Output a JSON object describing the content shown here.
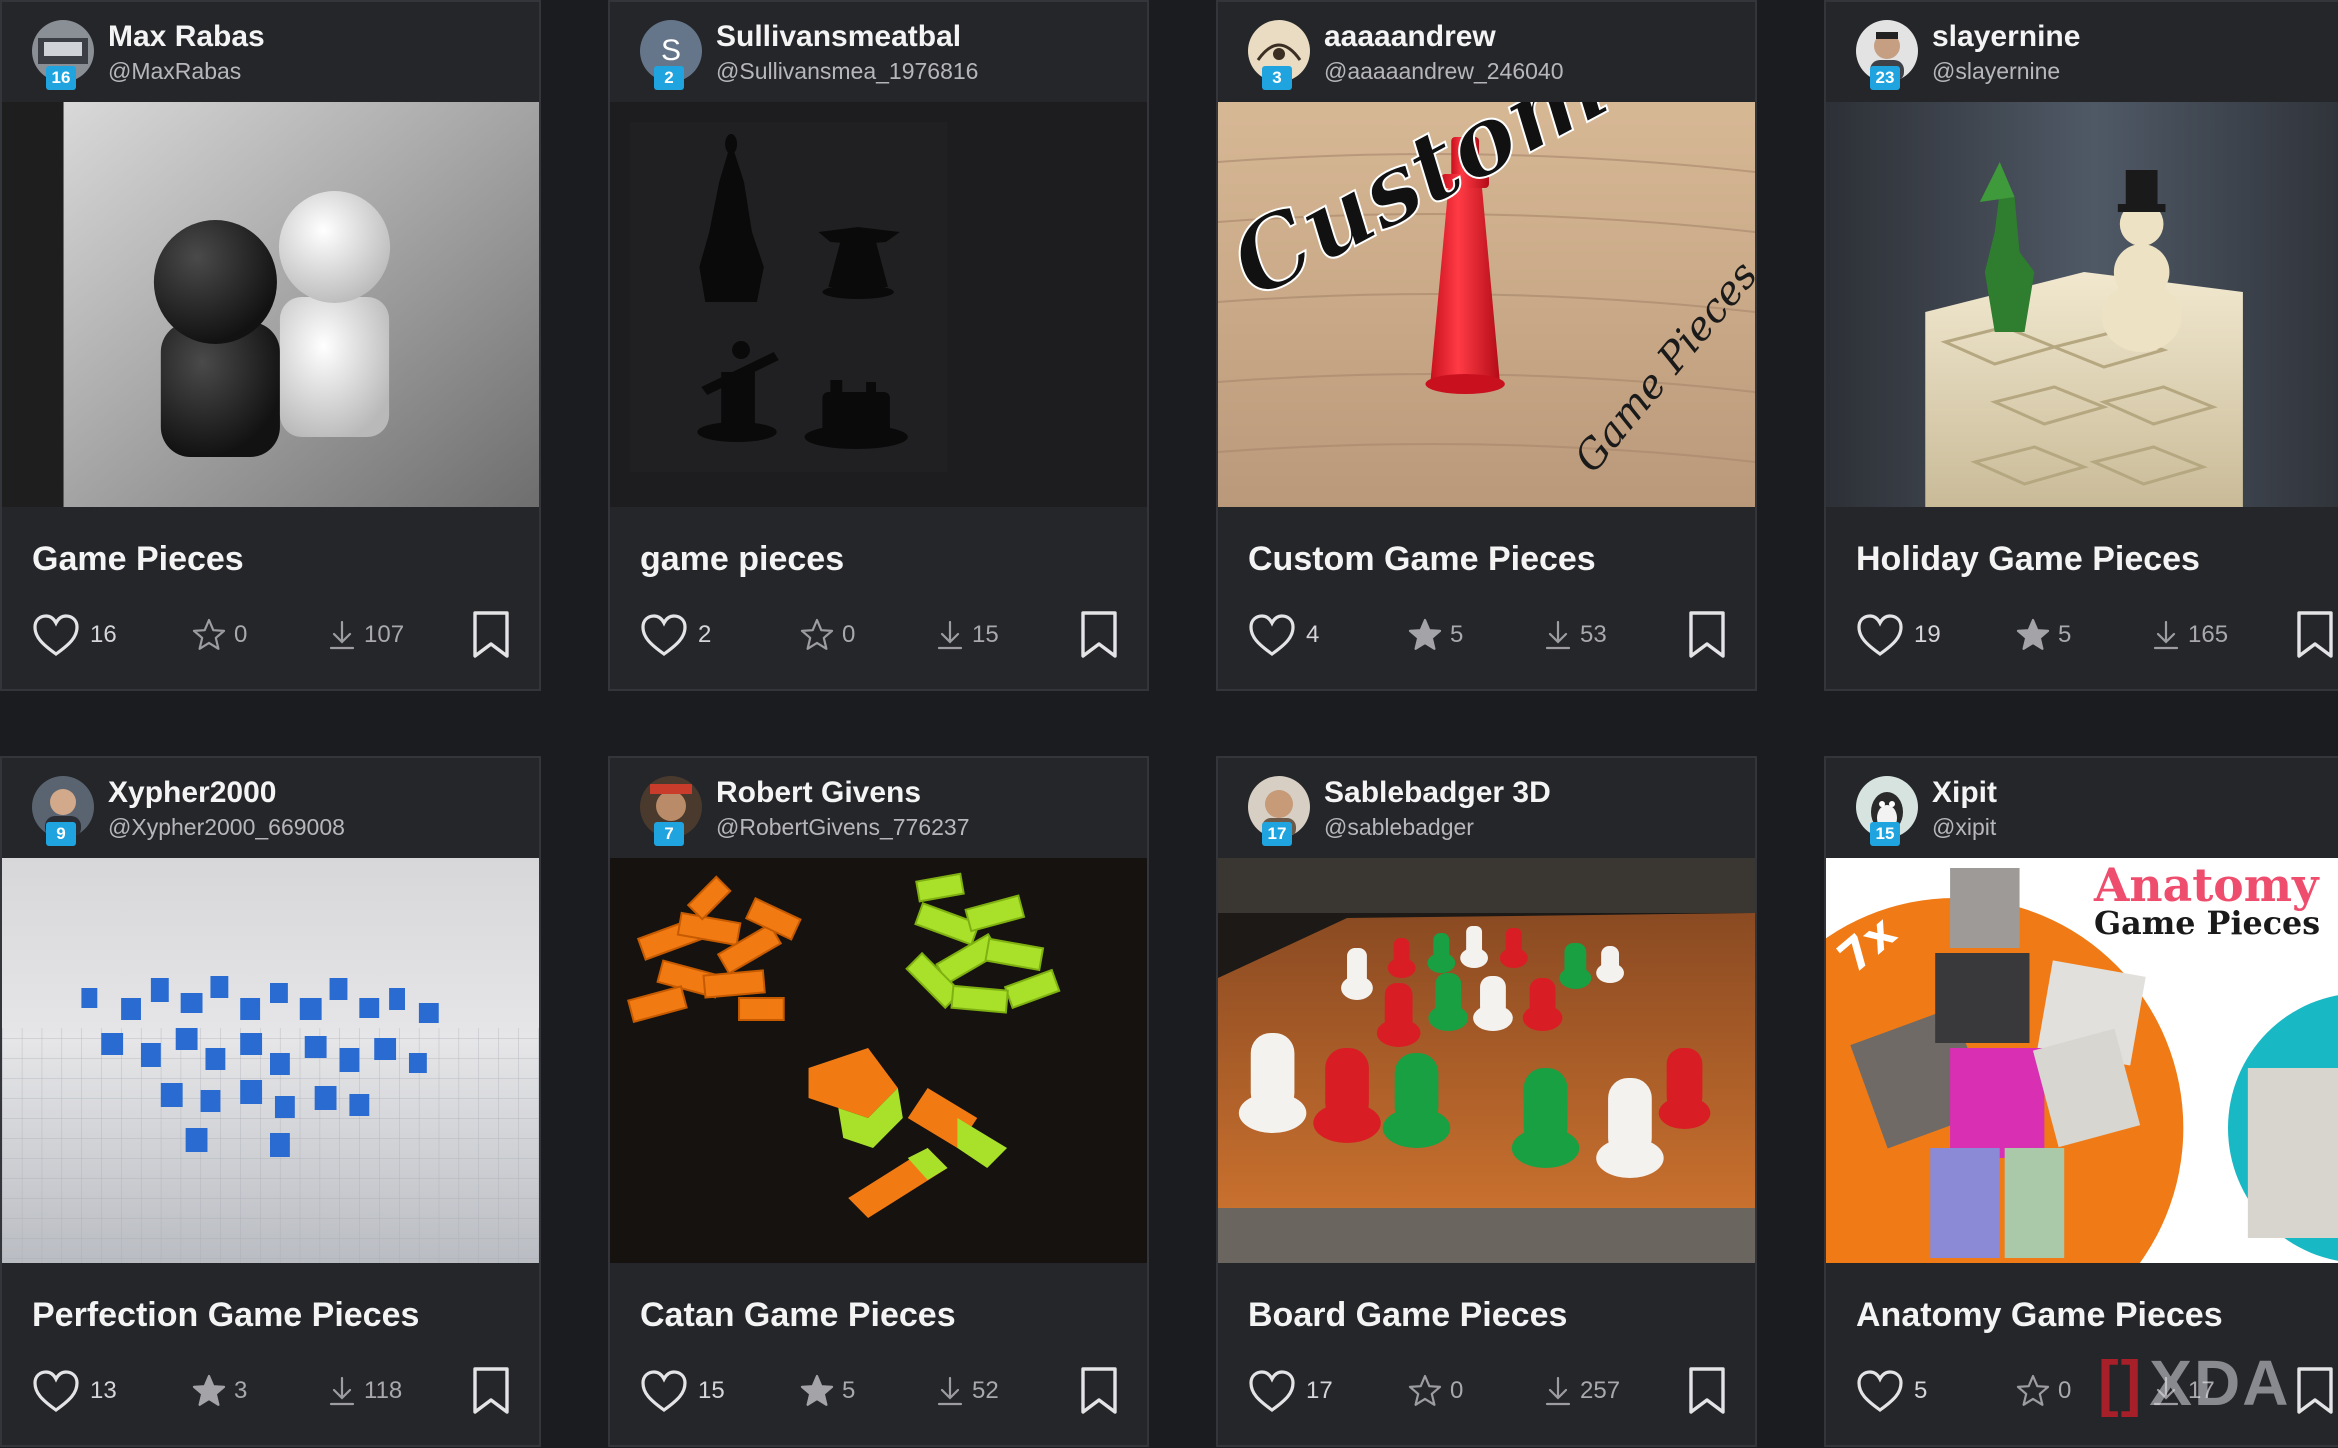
{
  "cards": [
    {
      "author": {
        "name": "Max Rabas",
        "handle": "@MaxRabas",
        "level": "16"
      },
      "title": "Game Pieces",
      "likes": "16",
      "stars": "0",
      "star_filled": false,
      "downloads": "107"
    },
    {
      "author": {
        "name": "Sullivansmeatbal",
        "handle": "@Sullivansmea_1976816",
        "level": "2",
        "initial": "S"
      },
      "title": "game pieces",
      "likes": "2",
      "stars": "0",
      "star_filled": false,
      "downloads": "15"
    },
    {
      "author": {
        "name": "aaaaandrew",
        "handle": "@aaaaandrew_246040",
        "level": "3"
      },
      "title": "Custom Game Pieces",
      "likes": "4",
      "stars": "5",
      "star_filled": true,
      "downloads": "53",
      "image_text": {
        "main": "Custom",
        "sub": "Game Pieces"
      }
    },
    {
      "author": {
        "name": "slayernine",
        "handle": "@slayernine",
        "level": "23"
      },
      "title": "Holiday Game Pieces",
      "likes": "19",
      "stars": "5",
      "star_filled": true,
      "downloads": "165"
    },
    {
      "author": {
        "name": "Xypher2000",
        "handle": "@Xypher2000_669008",
        "level": "9"
      },
      "title": "Perfection Game Pieces",
      "likes": "13",
      "stars": "3",
      "star_filled": true,
      "downloads": "118"
    },
    {
      "author": {
        "name": "Robert Givens",
        "handle": "@RobertGivens_776237",
        "level": "7"
      },
      "title": "Catan Game Pieces",
      "likes": "15",
      "stars": "5",
      "star_filled": true,
      "downloads": "52"
    },
    {
      "author": {
        "name": "Sablebadger 3D",
        "handle": "@sablebadger",
        "level": "17"
      },
      "title": "Board Game Pieces",
      "likes": "17",
      "stars": "0",
      "star_filled": false,
      "downloads": "257"
    },
    {
      "author": {
        "name": "Xipit",
        "handle": "@xipit",
        "level": "15"
      },
      "title": "Anatomy Game Pieces",
      "likes": "5",
      "stars": "0",
      "star_filled": false,
      "downloads": "17",
      "image_text": {
        "main": "Anatomy",
        "sub": "Game Pieces",
        "badge": "7x"
      }
    }
  ],
  "colors": {
    "accent_badge": "#1fa4e0",
    "card_bg": "#25262a",
    "page_bg": "#1b1c1f"
  },
  "icons": {
    "like": "heart-icon",
    "star": "star-icon",
    "download": "download-icon",
    "bookmark": "bookmark-icon"
  },
  "watermark": {
    "text": "XDA"
  }
}
